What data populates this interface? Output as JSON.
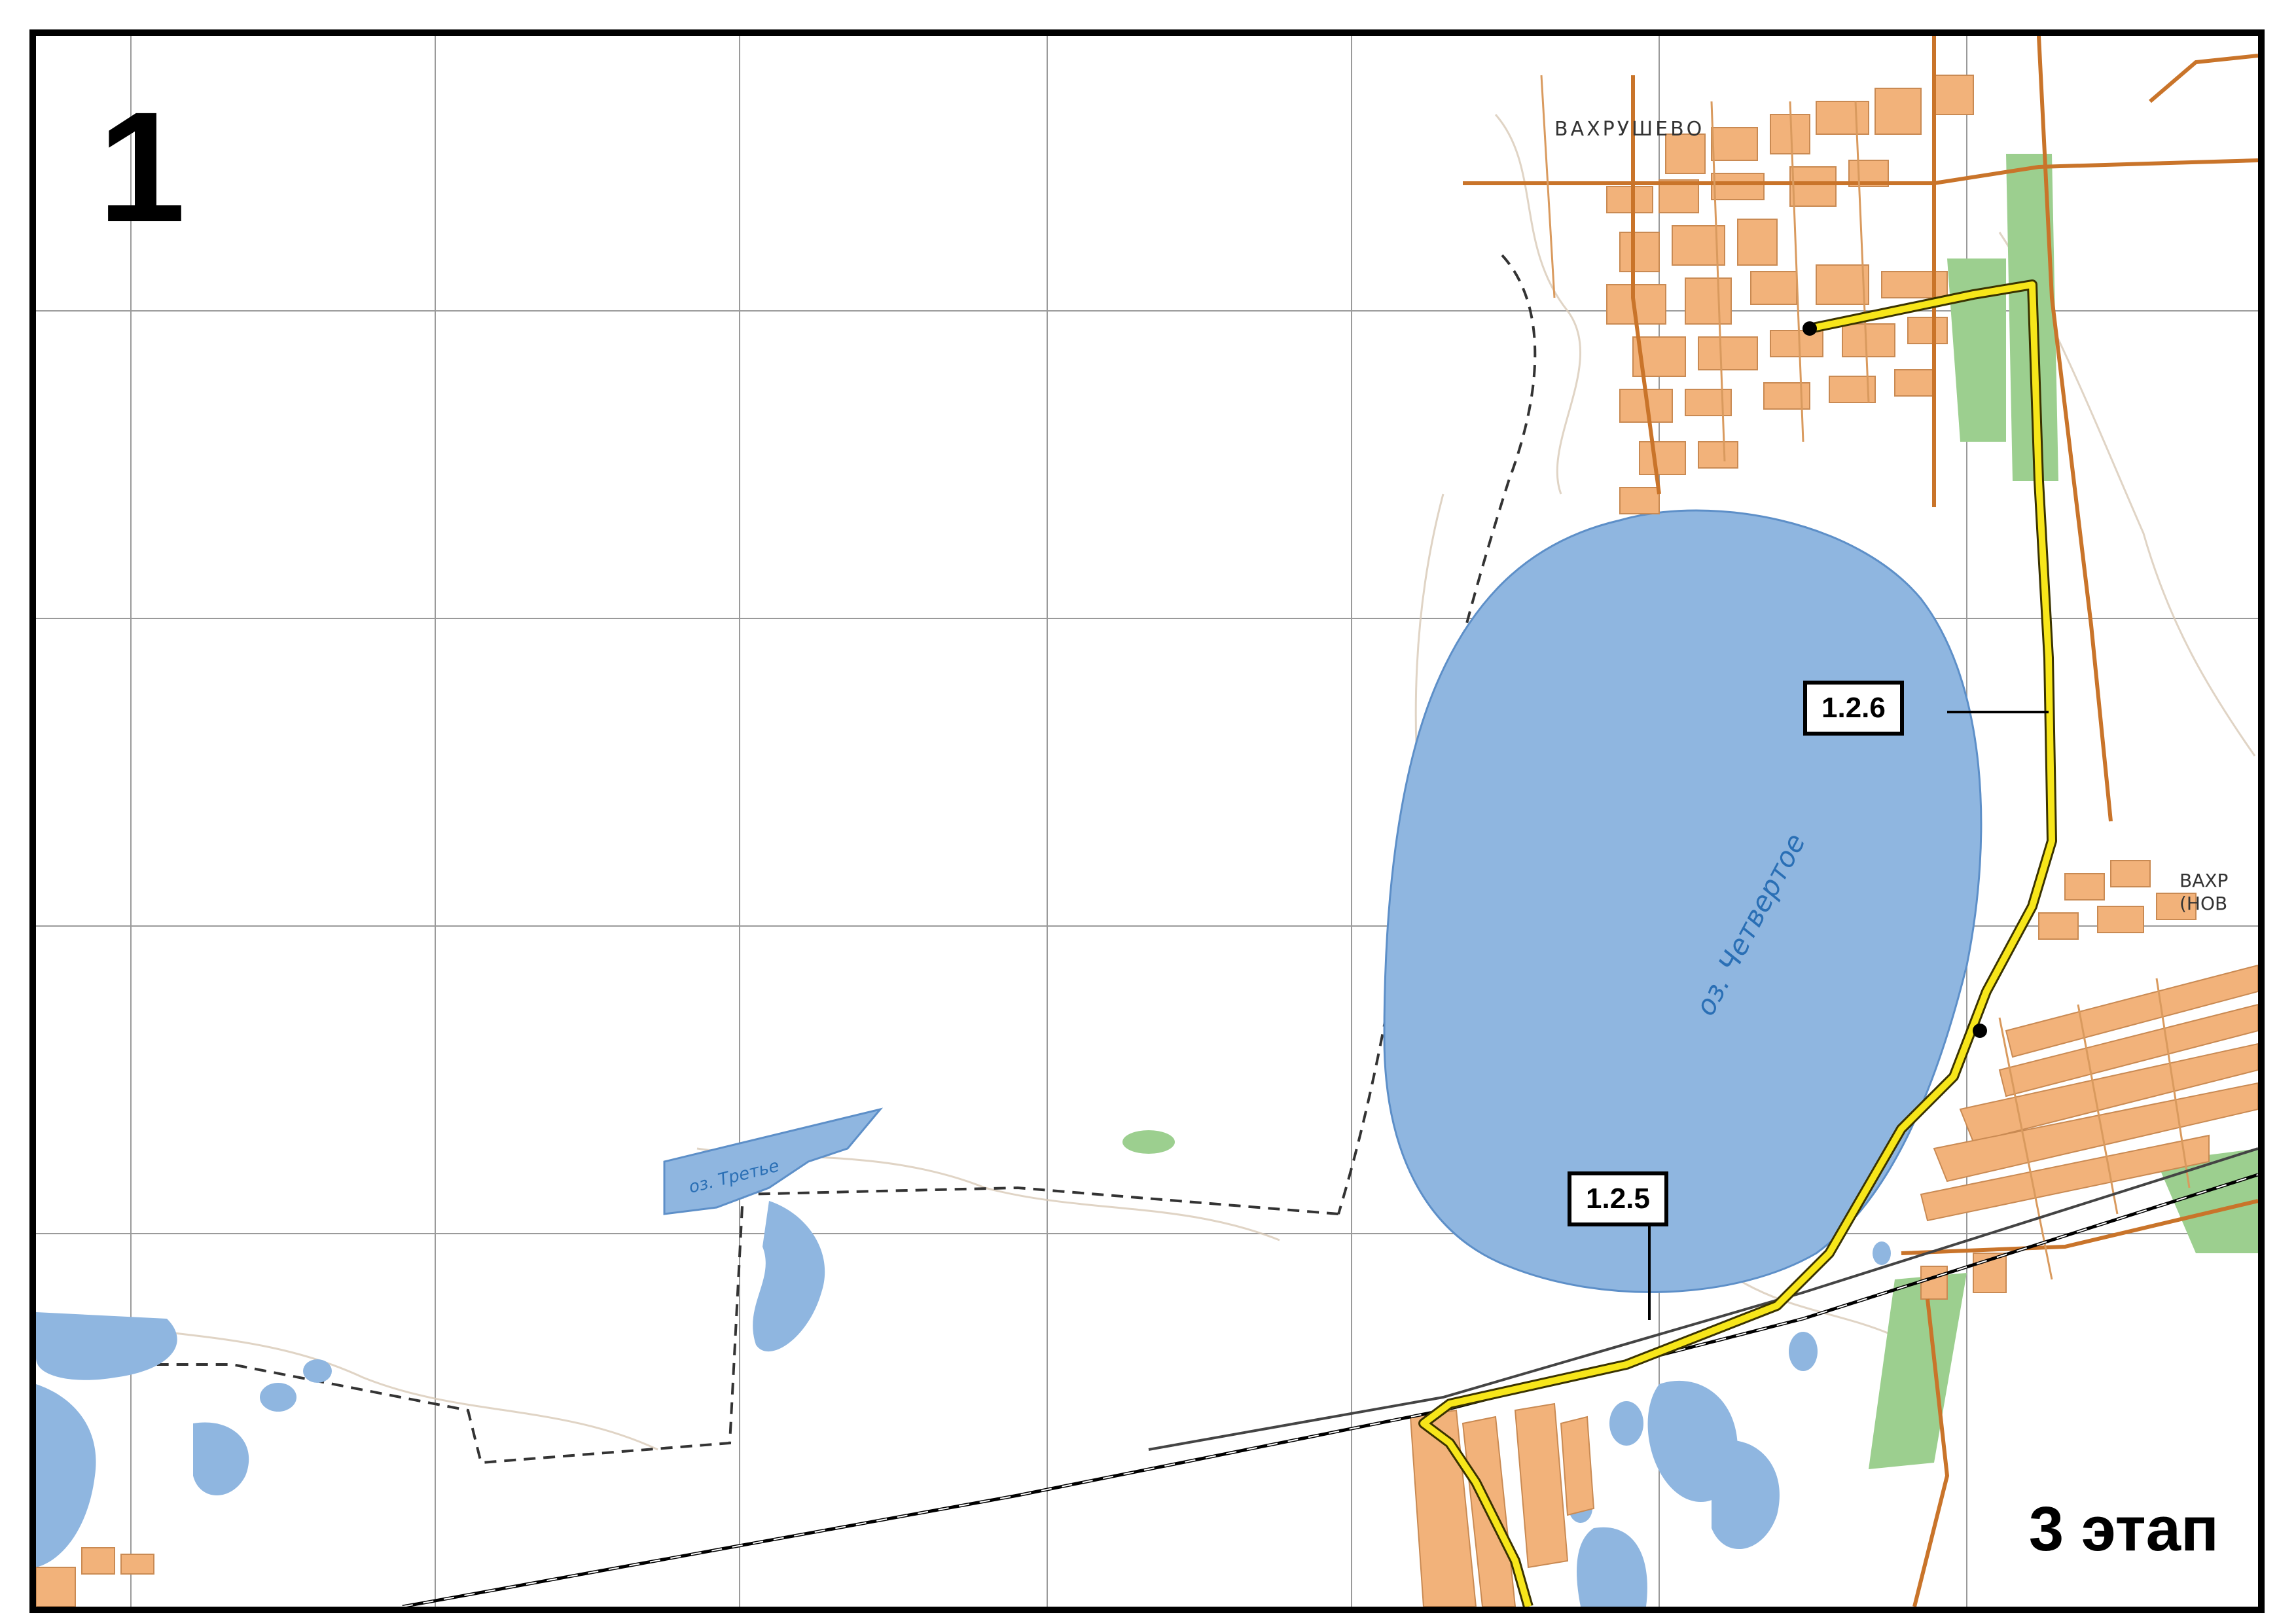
{
  "sheet_number": "1",
  "stage_label": "3 этап",
  "route_segments": [
    {
      "id": "1.2.5",
      "label": "1.2.5"
    },
    {
      "id": "1.2.6",
      "label": "1.2.6"
    }
  ],
  "place_names": {
    "village": "ВАХРУШЕВО",
    "village_east_partial": "ВАХР",
    "village_east_partial_2": "(НОВ"
  },
  "lakes": {
    "main": "оз. Четвертое",
    "west": "оз. Третье"
  },
  "colors": {
    "route": "#f7e61a",
    "water": "#8fb6e0",
    "built_up": "#f2b27a",
    "forest": "#9ccf8f",
    "road": "#c9742a",
    "grid": "#8c8c8c",
    "rail": "#000000"
  }
}
